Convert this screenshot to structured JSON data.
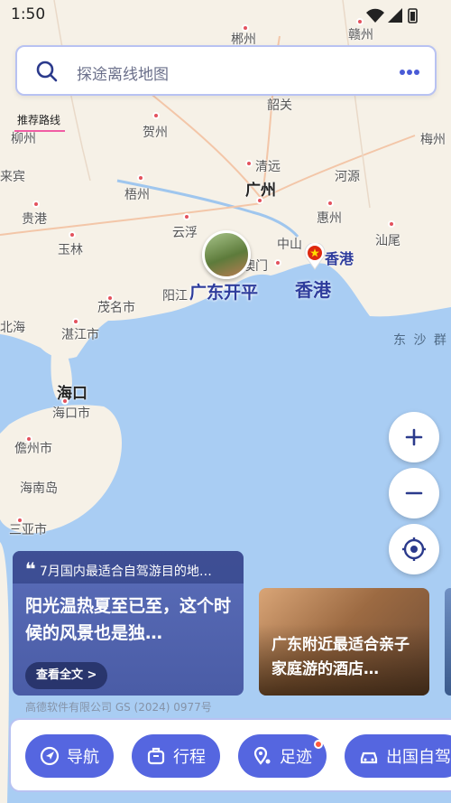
{
  "status": {
    "time": "1:50"
  },
  "search": {
    "placeholder": "探途离线地图"
  },
  "route": {
    "label": "推荐路线"
  },
  "map": {
    "cities": [
      "郴州",
      "赣州",
      "韶关",
      "梅州",
      "柳州",
      "贺州",
      "清远",
      "河源",
      "来宾",
      "梧州",
      "广州",
      "贵港",
      "惠州",
      "云浮",
      "玉林",
      "中山",
      "汕尾",
      "澳门",
      "茂名市",
      "阳江",
      "湛江市",
      "海口",
      "海口市",
      "儋州市",
      "海南岛",
      "三亚市",
      "北海"
    ],
    "sea_label": "东 沙 群 岛",
    "poi": {
      "name": "广东开平"
    },
    "hk": {
      "small": "香港",
      "big": "香港"
    }
  },
  "cards": {
    "main": {
      "title": "7月国内最适合自驾游目的地…",
      "body": "阳光温热夏至已至，这个时候的风景也是独…",
      "read_more": "查看全文 >"
    },
    "hotel": {
      "text": "广东附近最适合亲子家庭游的酒店…"
    }
  },
  "copyright": "高德软件有限公司 GS (2024) 0977号",
  "bottom": {
    "buttons": [
      "导航",
      "行程",
      "足迹",
      "出国自驾"
    ]
  },
  "colors": {
    "accent": "#5566e0",
    "land": "#f6f1e7",
    "sea": "#a9cdf3"
  }
}
